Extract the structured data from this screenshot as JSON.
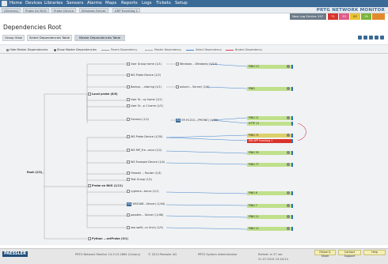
{
  "nav": {
    "items": [
      "Home",
      "Devices",
      "Libraries",
      "Sensors",
      "Alarms",
      "Maps",
      "Reports",
      "Logs",
      "Tickets",
      "Setup"
    ]
  },
  "breadcrumbs": [
    "(Devices)",
    "Probe Ari BUG",
    "Probe Device",
    "Windows Server",
    "ARP Eventlog 1"
  ],
  "brand": "PRTG NETWORK MONITOR",
  "header": {
    "log_entries": "New Log Entries 197",
    "alarms": [
      "71",
      "33",
      "62",
      "39"
    ]
  },
  "page_title": "Dependencies Root",
  "tabs": [
    "Group View",
    "Select Dependencies Table",
    "Master Dependencies Table"
  ],
  "controls": {
    "hide": "Hide Master Dependencies",
    "show": "Show Master Dependencies"
  },
  "legend": [
    "Parent Dependency",
    "Master Dependency",
    "Select Dependency",
    "Broken Dependency"
  ],
  "tree": {
    "root": "Root (2/3)",
    "level1": [
      "Local probe (6/6)",
      "Probe on BUG (1/11)",
      "Python ...ectProbe (0/1)"
    ],
    "level2": [
      "User Group home (1/1)",
      "WS Probe Device (1/2)",
      "Backup ...nitoring (1/1)",
      "User Gr...ny home (1/1)",
      "User Gr...p 1 home (1/1)",
      "Gensery (1/1)",
      "WS Probe Device (1/30)",
      "WS RIP_Fre...ence (1/1)",
      "WS Example Device (1/4)",
      "Firewall ... Router (1/3)",
      "Test Group (1/1)",
      "cyphere...tence (1/1)",
      "WS0168...Server) (1/44)",
      "passthe... Server) (1/48)",
      "sea swift...cs Unix) (1/5)"
    ],
    "level3": [
      "Windows ...Windows) (1/10)",
      "autoch... Server) (1/4)",
      "ER H1210...(PHONE) (1/40)"
    ]
  },
  "sensors": [
    {
      "label": "PING 13",
      "status": "ok"
    },
    {
      "label": "PING",
      "status": "ok"
    },
    {
      "label": "PING 11",
      "status": "ok"
    },
    {
      "label": "HTTP 11",
      "status": "ok"
    },
    {
      "label": "PING 71",
      "status": "warn"
    },
    {
      "label": "SW APP Eventlog 1",
      "status": "down"
    },
    {
      "label": "PING 55",
      "status": "ok"
    },
    {
      "label": "PING 77",
      "status": "ok"
    },
    {
      "label": "PING 6",
      "status": "ok"
    },
    {
      "label": "PING 7",
      "status": "ok"
    },
    {
      "label": "PING 11",
      "status": "ok"
    },
    {
      "label": "PING 12",
      "status": "ok"
    }
  ],
  "footer": {
    "logo": "PAESSLER",
    "version": "PRTG Network Monitor 14.3.10.2684 (Canary)",
    "copyright": "© 2014 Paessler AG",
    "user": "PRTG System Administrator",
    "refresh": "Refresh in 27 sec",
    "datetime": "21.07.2014 15:44:24",
    "buttons": [
      "Follow & Share",
      "Contact Support",
      "Help"
    ]
  },
  "colors": {
    "nav": "#3b6a97",
    "ok": "#bfe08a",
    "warn": "#dcd06a",
    "down": "#d9342b",
    "broken": "#d4385a",
    "select": "#3f83c9"
  }
}
